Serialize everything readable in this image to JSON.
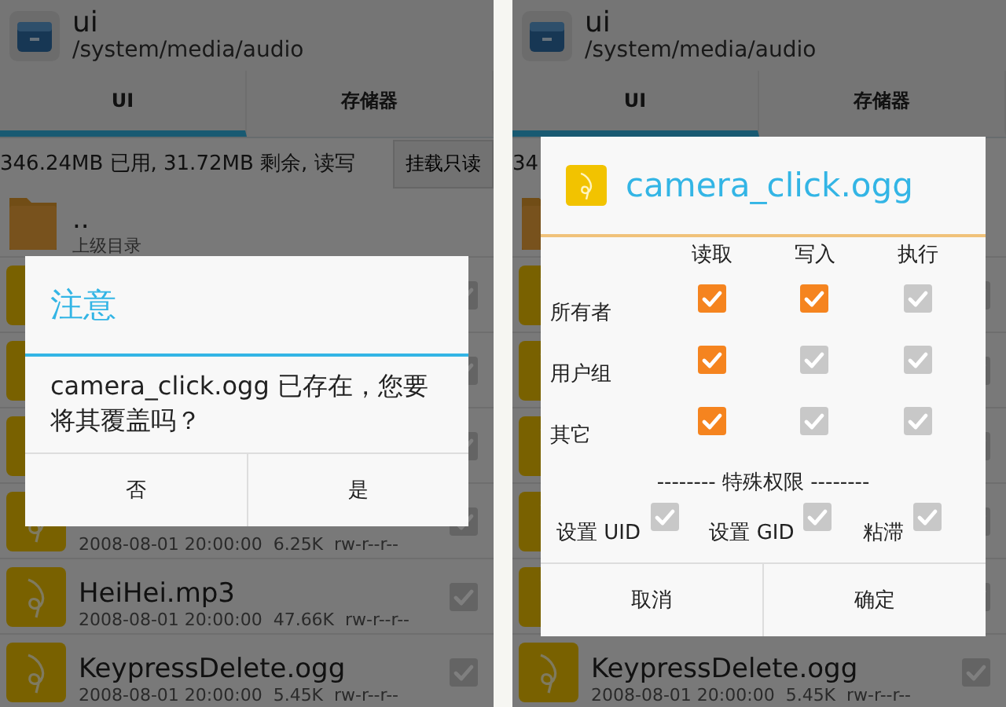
{
  "phones": [
    {
      "app": {
        "title": "ui",
        "path": "/system/media/audio"
      },
      "tabs": [
        {
          "label": "UI",
          "selected": true
        },
        {
          "label": "存储器",
          "selected": false
        }
      ],
      "storage": {
        "text": "346.24MB 已用, 31.72MB 剩余, 读写",
        "button": "挂载只读"
      },
      "files": [
        {
          "kind": "folder",
          "name": "..",
          "meta": "上级目录"
        },
        {
          "kind": "audio",
          "checked": false
        },
        {
          "kind": "audio",
          "checked": false
        },
        {
          "kind": "audio",
          "checked": false
        },
        {
          "kind": "audio",
          "checked": false,
          "meta": "2008-08-01 20:00:00  6.25K  rw-r--r--"
        },
        {
          "kind": "audio",
          "checked": false,
          "name": "HeiHei.mp3",
          "meta": "2008-08-01 20:00:00  47.66K  rw-r--r--"
        },
        {
          "kind": "audio",
          "checked": false,
          "name": "KeypressDelete.ogg",
          "meta": "2008-08-01 20:00:00  5.45K  rw-r--r--"
        }
      ],
      "dialog": {
        "kind": "confirm",
        "title": "注意",
        "message": "camera_click.ogg 已存在，您要将其覆盖吗？",
        "buttons": [
          "否",
          "是"
        ]
      }
    },
    {
      "app": {
        "title": "ui",
        "path": "/system/media/audio"
      },
      "tabs": [
        {
          "label": "UI",
          "selected": true
        },
        {
          "label": "存储器",
          "selected": false
        }
      ],
      "storage": {
        "text": "34"
      },
      "files": [
        {
          "kind": "folder"
        },
        {
          "kind": "audio",
          "checked": false
        },
        {
          "kind": "audio",
          "checked": false
        },
        {
          "kind": "audio",
          "checked": false
        },
        {
          "kind": "audio",
          "checked": false
        },
        {
          "kind": "audio",
          "checked": false
        },
        {
          "kind": "audio",
          "checked": false,
          "name": "KeypressDelete.ogg",
          "meta": "2008-08-01 20:00:00  5.45K  rw-r--r--"
        }
      ],
      "dialog": {
        "kind": "permissions",
        "title": "camera_click.ogg",
        "columns": [
          "读取",
          "写入",
          "执行"
        ],
        "rows": [
          {
            "label": "所有者",
            "cells": [
              {
                "checked": true
              },
              {
                "checked": true
              },
              {
                "checked": false
              }
            ]
          },
          {
            "label": "用户组",
            "cells": [
              {
                "checked": true
              },
              {
                "checked": false
              },
              {
                "checked": false
              }
            ]
          },
          {
            "label": "其它",
            "cells": [
              {
                "checked": true
              },
              {
                "checked": false
              },
              {
                "checked": false
              }
            ]
          }
        ],
        "special_title": "-------- 特殊权限 --------",
        "special": [
          {
            "label": "设置 UID",
            "checked": false
          },
          {
            "label": "设置 GID",
            "checked": false
          },
          {
            "label": "粘滞",
            "checked": false
          }
        ],
        "buttons": [
          "取消",
          "确定"
        ]
      }
    }
  ]
}
